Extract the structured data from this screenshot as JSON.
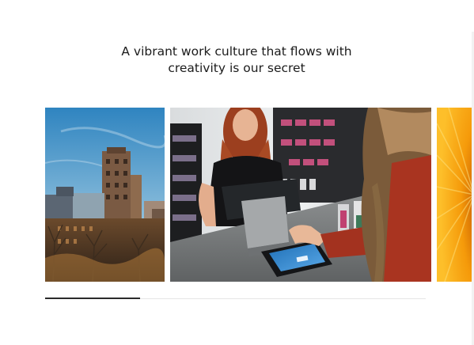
{
  "section": {
    "heading_line_1": "A vibrant work culture that flows with",
    "heading_line_2": "creativity is our secret"
  },
  "gallery": {
    "images": [
      {
        "name": "city-buildings-photo"
      },
      {
        "name": "store-checkout-payment-photo"
      },
      {
        "name": "yellow-flower-photo"
      }
    ],
    "progress": 0.25
  }
}
